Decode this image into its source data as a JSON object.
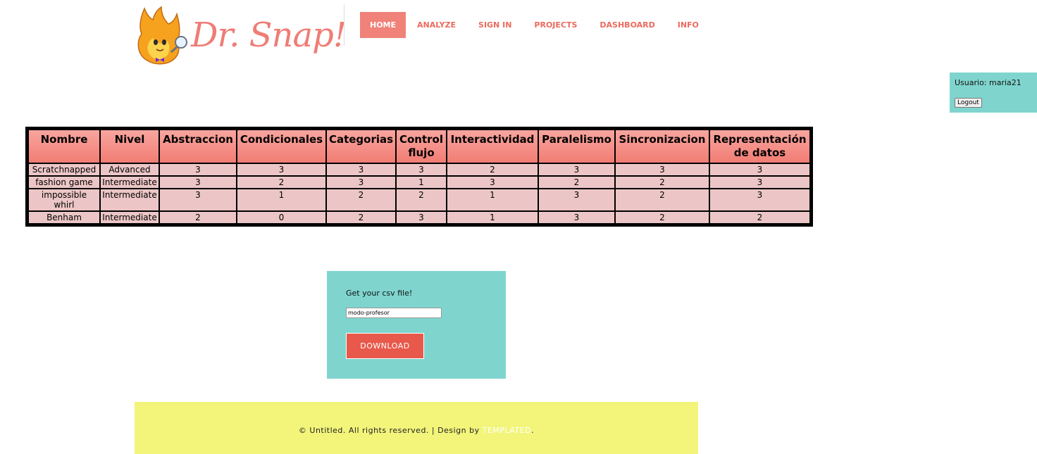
{
  "header": {
    "logo_text": "Dr. Snap!",
    "nav": [
      {
        "label": "HOME",
        "active": true
      },
      {
        "label": "ANALYZE",
        "active": false
      },
      {
        "label": "SIGN IN",
        "active": false
      },
      {
        "label": "PROJECTS",
        "active": false
      },
      {
        "label": "DASHBOARD",
        "active": false
      },
      {
        "label": "INFO",
        "active": false
      }
    ]
  },
  "user": {
    "label": "Usuario: maria21",
    "logout_label": "Logout"
  },
  "table": {
    "headers": [
      "Nombre",
      "Nivel",
      "Abstraccion",
      "Condicionales",
      "Categorias",
      "Control flujo",
      "Interactividad",
      "Paralelismo",
      "Sincronizacion",
      "Representación de datos"
    ],
    "rows": [
      [
        "Scratchnapped",
        "Advanced",
        "3",
        "3",
        "3",
        "3",
        "2",
        "3",
        "3",
        "3"
      ],
      [
        "fashion game",
        "Intermediate",
        "3",
        "2",
        "3",
        "1",
        "3",
        "2",
        "2",
        "3"
      ],
      [
        "impossible whirl",
        "Intermediate",
        "3",
        "1",
        "2",
        "2",
        "1",
        "3",
        "2",
        "3"
      ],
      [
        "Benham",
        "Intermediate",
        "2",
        "0",
        "2",
        "3",
        "1",
        "3",
        "2",
        "2"
      ]
    ]
  },
  "csv": {
    "title": "Get your csv file!",
    "input_value": "modo-profesor",
    "download_label": "DOWNLOAD"
  },
  "footer": {
    "text": "© Untitled. All rights reserved. | Design by ",
    "link": "TEMPLATED",
    "suffix": "."
  },
  "colors": {
    "accent": "#ec6a5e",
    "teal": "#7fd5ce",
    "footer_bg": "#f2f57a",
    "table_header": "#f17d74",
    "table_cell": "#ecc6c6"
  }
}
